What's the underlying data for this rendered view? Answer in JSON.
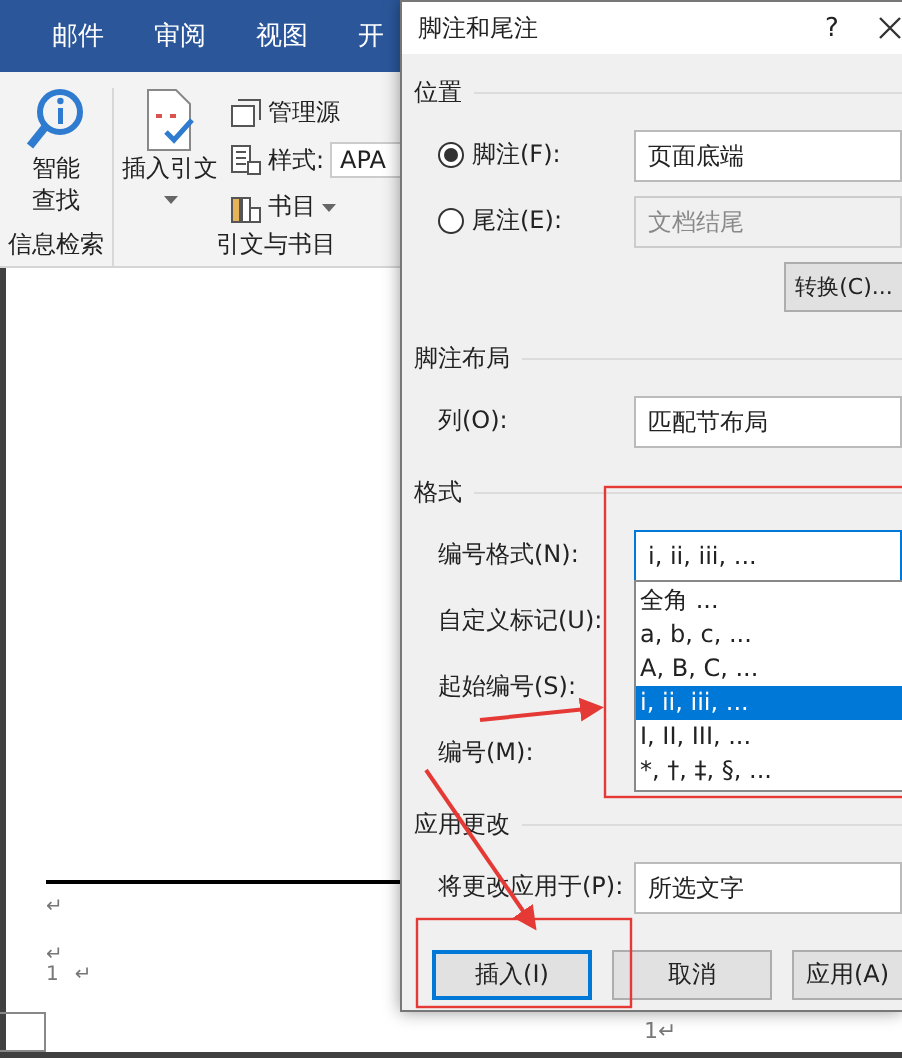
{
  "word": {
    "tabs": [
      {
        "label": "邮件"
      },
      {
        "label": "审阅"
      },
      {
        "label": "视图"
      },
      {
        "label": "开"
      }
    ],
    "lookup": {
      "lines": [
        "智能",
        "查找"
      ],
      "group": "信息检索"
    },
    "citations": {
      "insert": "插入引文",
      "manage": "管理源",
      "style_label": "样式:",
      "style_value": "APA",
      "bibliography": "书目",
      "group": "引文与书目"
    },
    "document": {
      "marks": [
        "↵",
        "↵"
      ],
      "footnote_number": "1",
      "footnote_mark": "↵",
      "page_number": "1↵"
    }
  },
  "dialog": {
    "title": "脚注和尾注",
    "help": "?",
    "location": {
      "heading": "位置",
      "options": [
        {
          "label": "脚注(F):",
          "selected": true,
          "value": "页面底端",
          "disabled": false
        },
        {
          "label": "尾注(E):",
          "selected": false,
          "value": "文档结尾",
          "disabled": true
        }
      ],
      "convert": "转换(C)..."
    },
    "layout": {
      "heading": "脚注布局",
      "label": "列(O):",
      "value": "匹配节布局"
    },
    "format": {
      "heading": "格式",
      "number_format_label": "编号格式(N):",
      "number_format_value": "i, ii, iii, ...",
      "expanded": true,
      "options": [
        {
          "label": "全角 ...",
          "selected": false
        },
        {
          "label": "a, b, c, ...",
          "selected": false
        },
        {
          "label": "A, B, C, ...",
          "selected": false
        },
        {
          "label": "i, ii, iii, ...",
          "selected": true
        },
        {
          "label": "I, II, III, ...",
          "selected": false
        },
        {
          "label": "*, †, ‡, §, ...",
          "selected": false
        }
      ],
      "custom_mark_label": "自定义标记(U):",
      "start_label": "起始编号(S):",
      "numbering_label": "编号(M):"
    },
    "apply": {
      "heading": "应用更改",
      "label": "将更改应用于(P):",
      "value": "所选文字"
    },
    "buttons": [
      {
        "label": "插入(I)",
        "focused": true
      },
      {
        "label": "取消",
        "focused": false
      },
      {
        "label": "应用(A)",
        "focused": false
      }
    ]
  }
}
